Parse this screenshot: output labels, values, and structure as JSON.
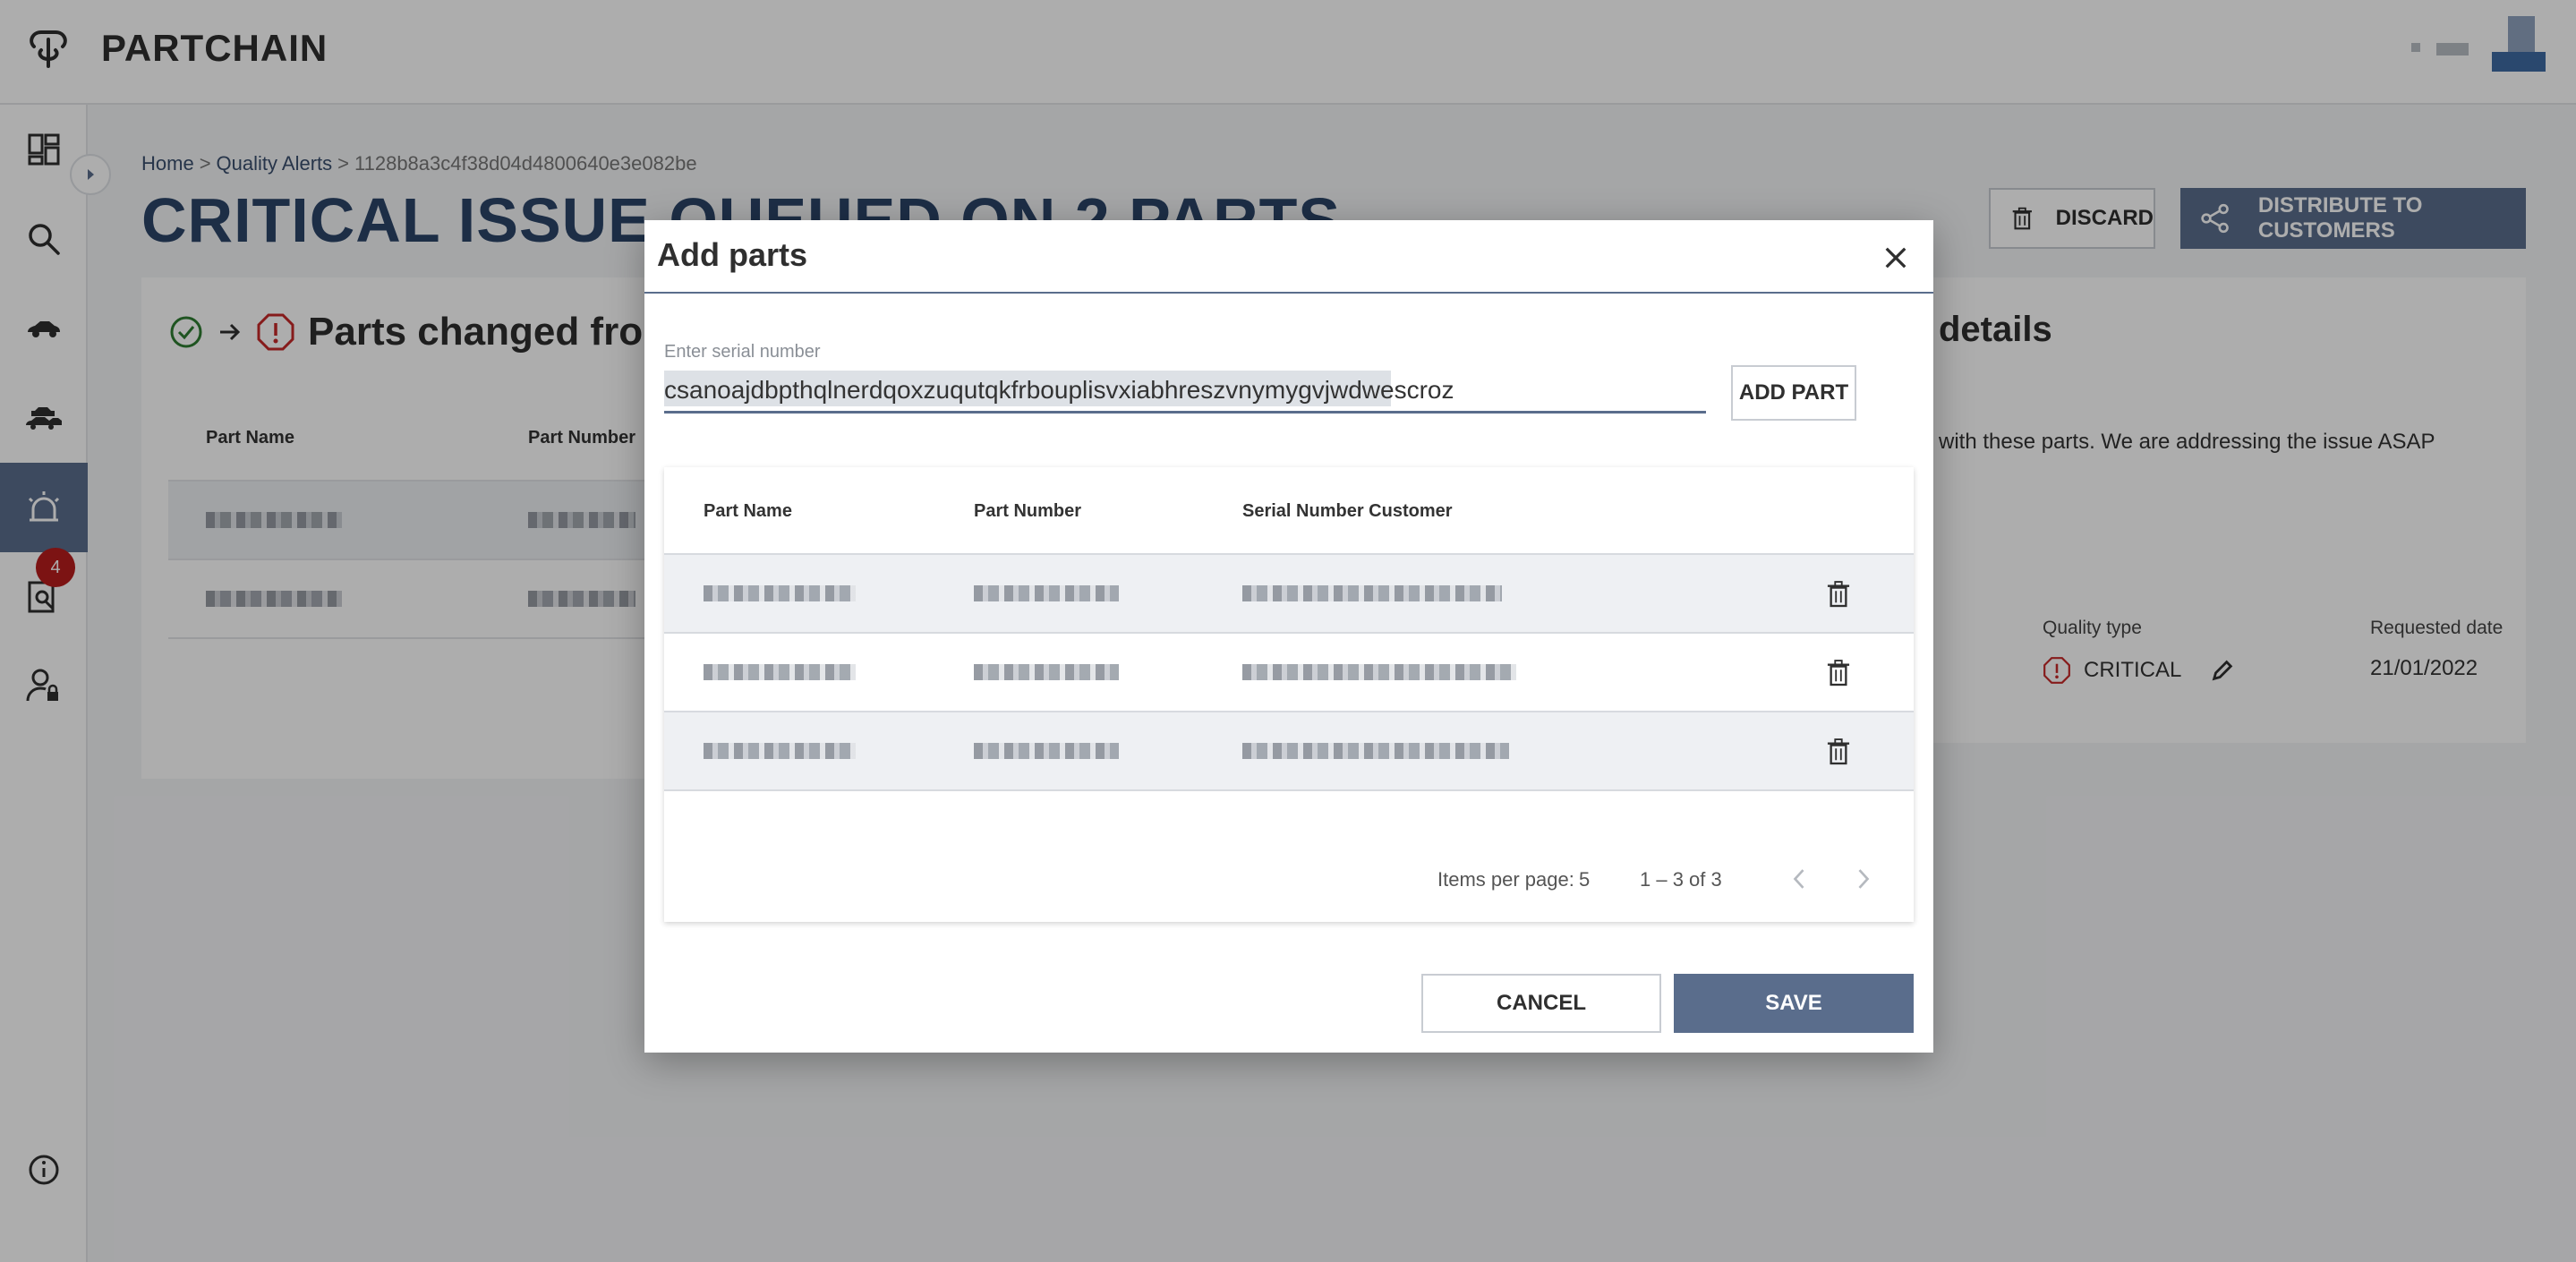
{
  "app": {
    "title": "PARTCHAIN"
  },
  "sidebar": {
    "items": [
      {
        "icon": "dashboard-icon",
        "label": "Dashboard"
      },
      {
        "icon": "search-icon",
        "label": "Parts"
      },
      {
        "icon": "car-icon",
        "label": "Other parts"
      },
      {
        "icon": "cars-icon",
        "label": "Relations"
      },
      {
        "icon": "alarm-icon",
        "label": "Quality alerts"
      },
      {
        "icon": "investigation-icon",
        "label": "Investigations"
      },
      {
        "icon": "admin-icon",
        "label": "Admin"
      },
      {
        "icon": "info-icon",
        "label": "About"
      }
    ],
    "investigations_badge": "4"
  },
  "breadcrumb": {
    "home": "Home",
    "quality_alerts": "Quality Alerts",
    "sep": ">",
    "current": "1128b8a3c4f38d04d4800640e3e082be"
  },
  "page": {
    "title": "CRITICAL ISSUE QUEUED ON 2 PARTS",
    "discard_label": "DISCARD",
    "distribute_label": "DISTRIBUTE TO CUSTOMERS"
  },
  "parts_section": {
    "title": "Parts changed from OK",
    "columns": [
      "Part Name",
      "Part Number"
    ]
  },
  "details": {
    "title": "details",
    "description": "with these parts. We are addressing the issue ASAP",
    "quality_type_label": "Quality type",
    "quality_type_value": "CRITICAL",
    "requested_date_label": "Requested date",
    "requested_date_value": "21/01/2022"
  },
  "dialog": {
    "title": "Add parts",
    "input_label": "Enter serial number",
    "input_value": "csanoajdbpthqlnerdqoxzuqutqkfrbouplisvxiabhreszvnymygvjwdwescroz",
    "add_part_label": "ADD PART",
    "table": {
      "columns": [
        "Part Name",
        "Part Number",
        "Serial Number Customer"
      ]
    },
    "paginator": {
      "items_per_page_label": "Items per page:",
      "items_per_page_value": "5",
      "range": "1 – 3 of 3"
    },
    "cancel_label": "CANCEL",
    "save_label": "SAVE"
  }
}
